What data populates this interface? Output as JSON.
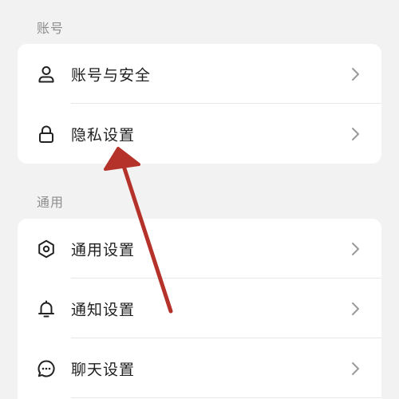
{
  "sections": [
    {
      "title": "账号",
      "items": [
        {
          "label": "账号与安全",
          "icon": "user-icon"
        },
        {
          "label": "隐私设置",
          "icon": "lock-icon"
        }
      ]
    },
    {
      "title": "通用",
      "items": [
        {
          "label": "通用设置",
          "icon": "gear-icon"
        },
        {
          "label": "通知设置",
          "icon": "bell-icon"
        },
        {
          "label": "聊天设置",
          "icon": "chat-bubble-icon"
        }
      ]
    }
  ],
  "colors": {
    "background": "#f2f2f2",
    "card": "#ffffff",
    "section_title": "#8d8d8d",
    "label": "#1f1f1f",
    "chevron": "#9a9a9a",
    "annotation_arrow": "#b5322a"
  }
}
